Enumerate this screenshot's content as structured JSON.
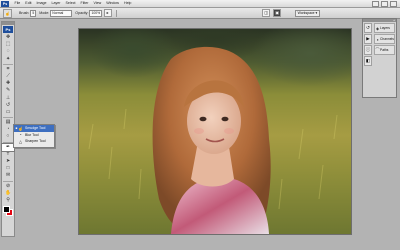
{
  "app": {
    "logo_text": "Ps"
  },
  "menubar": {
    "items": [
      "File",
      "Edit",
      "Image",
      "Layer",
      "Select",
      "Filter",
      "View",
      "Window",
      "Help"
    ]
  },
  "options_bar": {
    "brush_label": "Brush:",
    "brush_value": "5",
    "mode_label": "Mode:",
    "mode_value": "Normal",
    "opacity_label": "Opacity:",
    "opacity_value": "100%",
    "workspace_label": "Workspace ▾"
  },
  "toolbox": {
    "tools": [
      {
        "name": "move-tool-icon",
        "glyph": "✥"
      },
      {
        "name": "marquee-tool-icon",
        "glyph": "⬚"
      },
      {
        "name": "lasso-tool-icon",
        "glyph": "◌"
      },
      {
        "name": "magic-wand-tool-icon",
        "glyph": "✦"
      },
      {
        "name": "crop-tool-icon",
        "glyph": "⌗"
      },
      {
        "name": "slice-tool-icon",
        "glyph": "⟋"
      },
      {
        "name": "healing-brush-tool-icon",
        "glyph": "✚"
      },
      {
        "name": "brush-tool-icon",
        "glyph": "✎"
      },
      {
        "name": "clone-stamp-tool-icon",
        "glyph": "⊥"
      },
      {
        "name": "history-brush-tool-icon",
        "glyph": "↺"
      },
      {
        "name": "eraser-tool-icon",
        "glyph": "▭"
      },
      {
        "name": "gradient-tool-icon",
        "glyph": "▤"
      },
      {
        "name": "blur-tool-icon",
        "glyph": "◔"
      },
      {
        "name": "dodge-tool-icon",
        "glyph": "○"
      },
      {
        "name": "pen-tool-icon",
        "glyph": "✒"
      },
      {
        "name": "type-tool-icon",
        "glyph": "T"
      },
      {
        "name": "path-selection-tool-icon",
        "glyph": "➤"
      },
      {
        "name": "rectangle-tool-icon",
        "glyph": "□"
      },
      {
        "name": "notes-tool-icon",
        "glyph": "✉"
      },
      {
        "name": "eyedropper-tool-icon",
        "glyph": "⊘"
      },
      {
        "name": "hand-tool-icon",
        "glyph": "✋"
      },
      {
        "name": "zoom-tool-icon",
        "glyph": "⚲"
      }
    ],
    "active_tool_index": 14,
    "foreground_color": "#000000",
    "background_color": "#e30613"
  },
  "flyout": {
    "items": [
      {
        "label": "Smudge Tool",
        "icon": "smudge-icon",
        "glyph": "☝",
        "selected": true
      },
      {
        "label": "Blur Tool",
        "icon": "blur-icon",
        "glyph": "◔",
        "selected": false
      },
      {
        "label": "Sharpen Tool",
        "icon": "sharpen-icon",
        "glyph": "△",
        "selected": false
      }
    ]
  },
  "panels": {
    "strip_icons": [
      {
        "name": "history-panel-icon",
        "glyph": "↺"
      },
      {
        "name": "actions-panel-icon",
        "glyph": "▶"
      },
      {
        "name": "info-panel-icon",
        "glyph": "ⓘ"
      },
      {
        "name": "navigator-panel-icon",
        "glyph": "◧"
      }
    ],
    "items": [
      {
        "label": "Layers",
        "icon": "layers-icon",
        "glyph": "◈"
      },
      {
        "label": "Channels",
        "icon": "channels-icon",
        "glyph": "◑"
      },
      {
        "label": "Paths",
        "icon": "paths-icon",
        "glyph": "⌒"
      }
    ]
  },
  "colors": {
    "accent": "#3e6fc0",
    "ps_brand": "#1f4f9c",
    "workspace_bg": "#b3b3b3"
  }
}
